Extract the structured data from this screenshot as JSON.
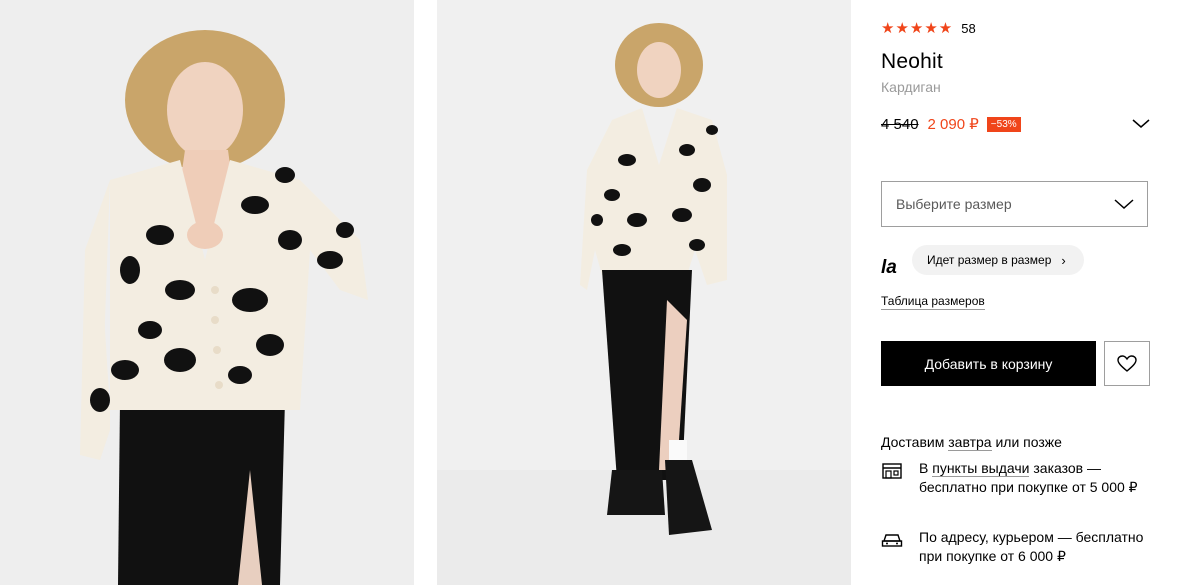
{
  "product": {
    "rating_stars": "★★★★★",
    "rating_count": "58",
    "brand": "Neohit",
    "category": "Кардиган",
    "old_price": "4 540",
    "new_price": "2 090 ₽",
    "discount": "−53%"
  },
  "size": {
    "placeholder": "Выберите размер",
    "fit_logo": "la",
    "fit_label": "Идет размер в размер",
    "table_link": "Таблица размеров"
  },
  "actions": {
    "add_to_cart": "Добавить в корзину",
    "favorite_icon": "heart-icon"
  },
  "delivery": {
    "head_pre": "Доставим ",
    "head_link": "завтра",
    "head_post": " или позже",
    "options": [
      {
        "icon": "pickup-point-icon",
        "pre": "В ",
        "link": "пункты выдачи",
        "post": " заказов — бесплатно при покупке от 5 000 ₽"
      },
      {
        "icon": "car-icon",
        "pre": "",
        "link": "",
        "post": "По адресу, курьером — бесплатно при покупке от 6 000 ₽"
      }
    ]
  },
  "colors": {
    "accent": "#f0451a",
    "button": "#000000"
  }
}
